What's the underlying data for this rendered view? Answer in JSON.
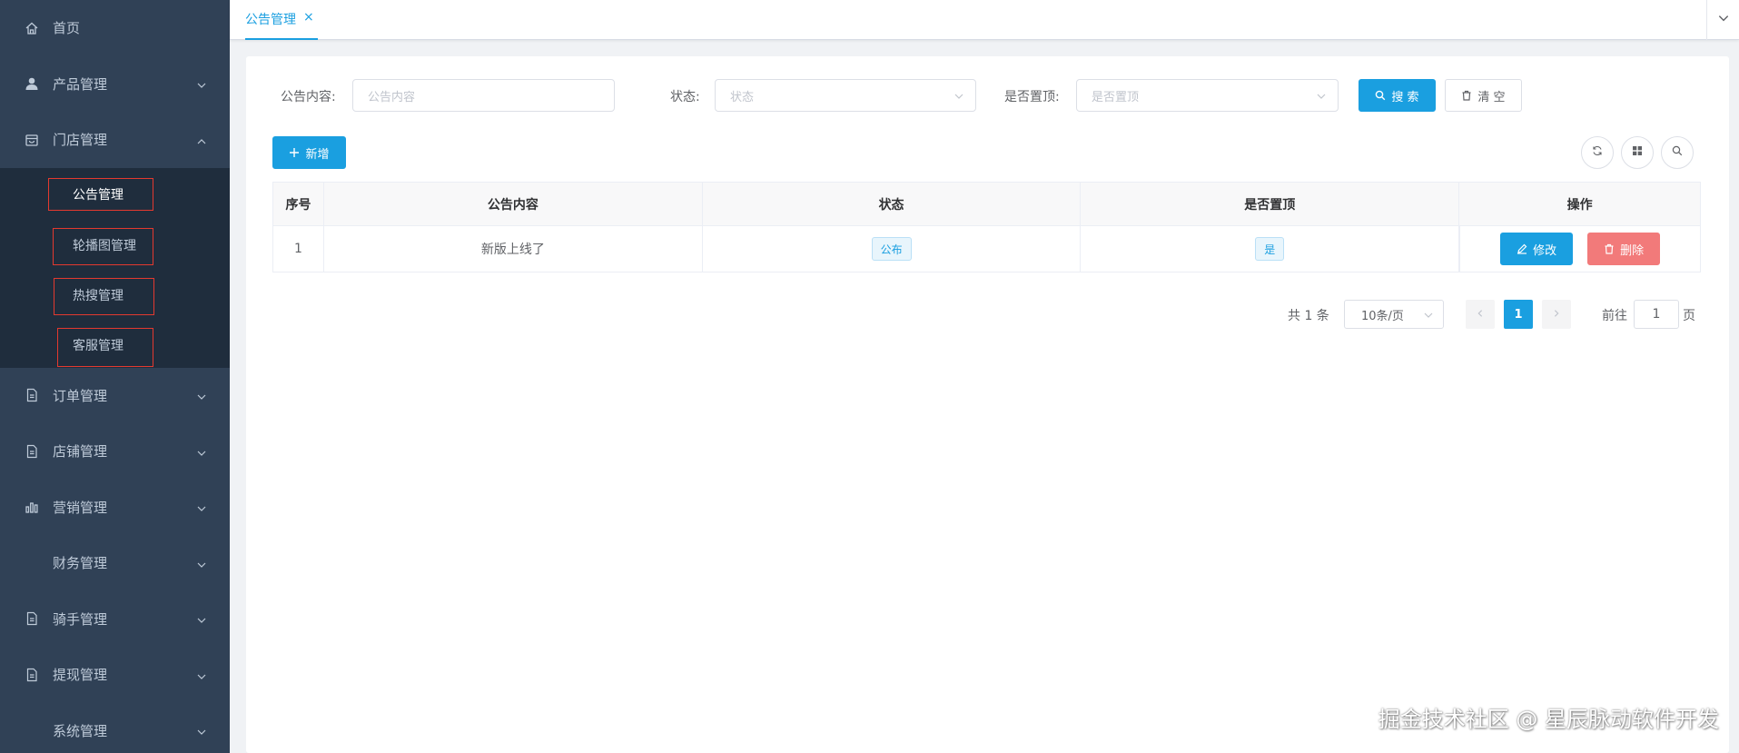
{
  "sidebar": {
    "items": [
      {
        "label": "首页",
        "icon": "home-icon",
        "expandable": false
      },
      {
        "label": "产品管理",
        "icon": "user-icon",
        "expandable": true
      },
      {
        "label": "门店管理",
        "icon": "store-icon",
        "expandable": true,
        "expanded": true
      },
      {
        "label": "订单管理",
        "icon": "document-icon",
        "expandable": true
      },
      {
        "label": "店铺管理",
        "icon": "document-icon",
        "expandable": true
      },
      {
        "label": "营销管理",
        "icon": "bar-chart-icon",
        "expandable": true
      },
      {
        "label": "财务管理",
        "icon": "",
        "expandable": true
      },
      {
        "label": "骑手管理",
        "icon": "document-icon",
        "expandable": true
      },
      {
        "label": "提现管理",
        "icon": "document-icon",
        "expandable": true
      },
      {
        "label": "系统管理",
        "icon": "",
        "expandable": true
      }
    ],
    "submenu": [
      {
        "label": "公告管理",
        "active": true
      },
      {
        "label": "轮播图管理",
        "active": false
      },
      {
        "label": "热搜管理",
        "active": false
      },
      {
        "label": "客服管理",
        "active": false
      }
    ]
  },
  "tags": {
    "active_label": "公告管理",
    "close_glyph": "×"
  },
  "search": {
    "content_label": "公告内容:",
    "content_placeholder": "公告内容",
    "status_label": "状态:",
    "status_placeholder": "状态",
    "top_label": "是否置顶:",
    "top_placeholder": "是否置顶",
    "search_btn": "搜 索",
    "clear_btn": "清 空"
  },
  "toolbar": {
    "add_btn": "新增"
  },
  "table": {
    "headers": [
      "序号",
      "公告内容",
      "状态",
      "是否置顶",
      "操作"
    ],
    "rows": [
      {
        "index": "1",
        "content": "新版上线了",
        "status": "公布",
        "top": "是",
        "edit": "修改",
        "delete": "删除"
      }
    ]
  },
  "pagination": {
    "total": "共 1 条",
    "page_size": "10条/页",
    "current_page": "1",
    "goto_label": "前往",
    "goto_value": "1",
    "page_unit": "页"
  },
  "watermark": "掘金技术社区 @ 星辰脉动软件开发",
  "colors": {
    "primary": "#1a9fe0",
    "sidebar_bg": "#304156",
    "submenu_bg": "#1f2d3d",
    "danger": "#f27a7a",
    "highlight_box": "#e3392f"
  }
}
